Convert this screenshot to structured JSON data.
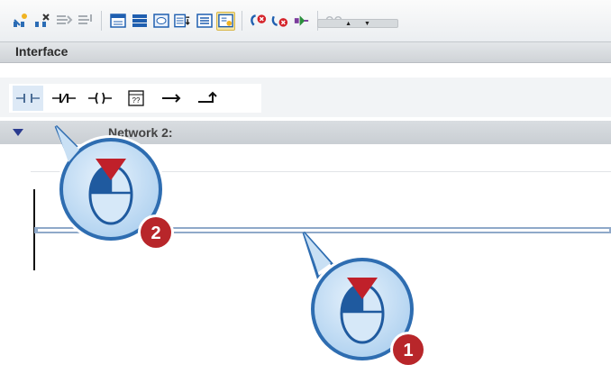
{
  "toolbar": {
    "items": [
      {
        "name": "insert-network-icon"
      },
      {
        "name": "delete-network-icon"
      },
      {
        "name": "insert-row-icon"
      },
      {
        "name": "append-row-icon"
      },
      {
        "name": "separator"
      },
      {
        "name": "open-all-networks-icon"
      },
      {
        "name": "close-all-networks-icon"
      },
      {
        "name": "network-comments-icon"
      },
      {
        "name": "absolute-relative-operand-icon"
      },
      {
        "name": "favorites-icon"
      },
      {
        "name": "call-hierarchy-icon"
      },
      {
        "name": "separator"
      },
      {
        "name": "go-to-previous-error-icon"
      },
      {
        "name": "go-to-next-error-icon"
      },
      {
        "name": "update-block-calls-icon"
      },
      {
        "name": "separator"
      },
      {
        "name": "monitoring-glasses-icon"
      }
    ]
  },
  "interface": {
    "title": "Interface"
  },
  "palette": {
    "items": [
      {
        "name": "normally-open-contact-icon",
        "active": true
      },
      {
        "name": "normally-closed-contact-icon",
        "active": false
      },
      {
        "name": "coil-icon",
        "active": false
      },
      {
        "name": "empty-box-icon",
        "label": "??",
        "active": false
      },
      {
        "name": "open-branch-icon",
        "active": false
      },
      {
        "name": "close-branch-icon",
        "active": false
      }
    ]
  },
  "network": {
    "title": "Network 2:"
  },
  "callouts": [
    {
      "number": "2",
      "color": "#b8262a"
    },
    {
      "number": "1",
      "color": "#b8262a"
    }
  ],
  "colors": {
    "callout_fill": "#c9e0f4",
    "callout_stroke": "#2e6db1",
    "arrow_red": "#c0202a",
    "rung": "#8fa9c9"
  }
}
